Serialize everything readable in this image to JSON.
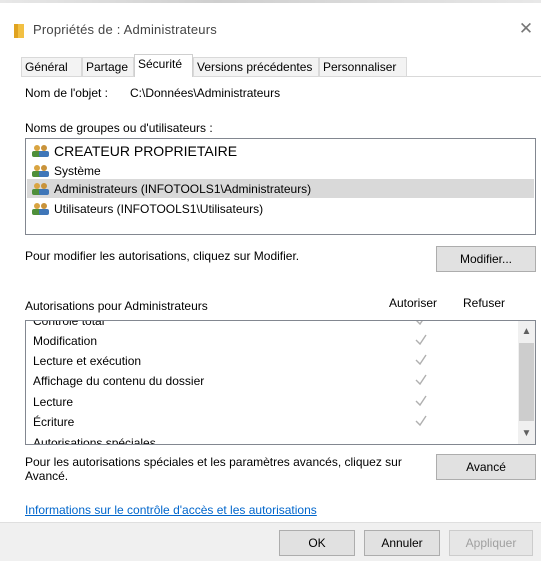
{
  "window": {
    "title": "Propriétés de : Administrateurs",
    "close_glyph": "✕",
    "icon": "folder-icon"
  },
  "tabs": [
    {
      "label": "Général"
    },
    {
      "label": "Partage"
    },
    {
      "label": "Sécurité",
      "active": true
    },
    {
      "label": "Versions précédentes"
    },
    {
      "label": "Personnaliser"
    }
  ],
  "object": {
    "label": "Nom de l'objet :",
    "value": "C:\\Données\\Administrateurs"
  },
  "groups": {
    "label": "Noms de groupes ou d'utilisateurs :",
    "items": [
      {
        "name": "CREATEUR PROPRIETAIRE",
        "icon": "user-group-icon"
      },
      {
        "name": "Système",
        "icon": "user-group-icon"
      },
      {
        "name": "Administrateurs (INFOTOOLS1\\Administrateurs)",
        "icon": "user-group-icon",
        "selected": true
      },
      {
        "name": "Utilisateurs (INFOTOOLS1\\Utilisateurs)",
        "icon": "user-group-icon"
      }
    ]
  },
  "modify": {
    "hint": "Pour modifier les autorisations, cliquez sur Modifier.",
    "button": "Modifier..."
  },
  "permissions": {
    "label": "Autorisations pour Administrateurs",
    "allow_header": "Autoriser",
    "deny_header": "Refuser",
    "rows": [
      {
        "name": "Contrôle total",
        "allow": true
      },
      {
        "name": "Modification",
        "allow": true
      },
      {
        "name": "Lecture et exécution",
        "allow": true
      },
      {
        "name": "Affichage du contenu du dossier",
        "allow": true
      },
      {
        "name": "Lecture",
        "allow": true
      },
      {
        "name": "Écriture",
        "allow": true
      },
      {
        "name": "Autorisations spéciales",
        "allow": false
      }
    ]
  },
  "advanced": {
    "hint": "Pour les autorisations spéciales et les paramètres avancés, cliquez sur Avancé.",
    "hint_line1": "Pour les autorisations spéciales et les paramètres avancés, cliquez sur",
    "hint_line2": "Avancé.",
    "button": "Avancé"
  },
  "info_link": "Informations sur le contrôle d'accès et les autorisations",
  "footer": {
    "ok": "OK",
    "cancel": "Annuler",
    "apply": "Appliquer"
  },
  "colors": {
    "selection": "#d9d9d9",
    "link": "#0066cc",
    "check": "#b0b0b0"
  }
}
